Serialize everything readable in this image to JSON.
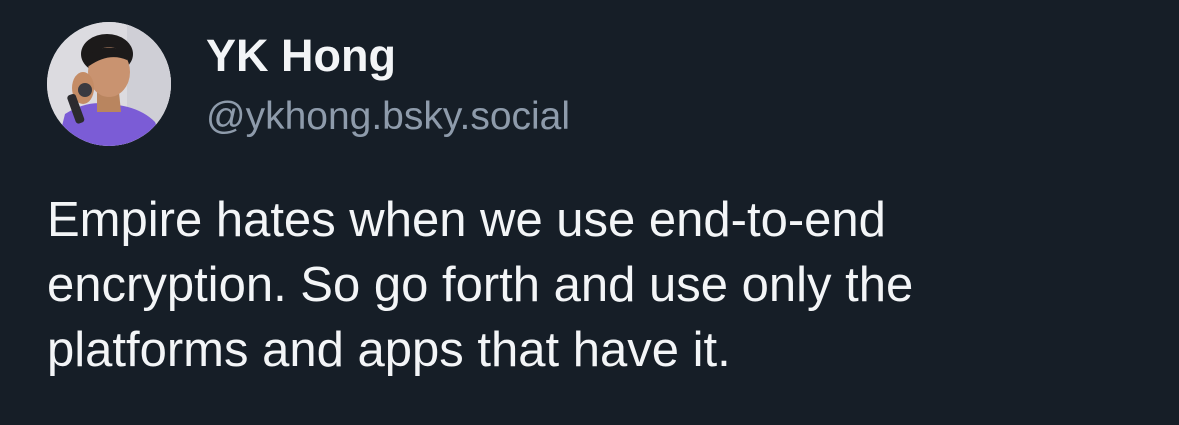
{
  "post": {
    "author": {
      "display_name": "YK Hong",
      "handle": "@ykhong.bsky.social",
      "avatar_icon": "profile-photo-avatar"
    },
    "text_lines": [
      "Empire hates when we use end-to-end",
      "encryption. So go forth and use only the",
      "platforms and apps that have it."
    ]
  },
  "colors": {
    "background": "#161e27",
    "text": "#f3f5f7",
    "handle": "#8e9bab"
  }
}
